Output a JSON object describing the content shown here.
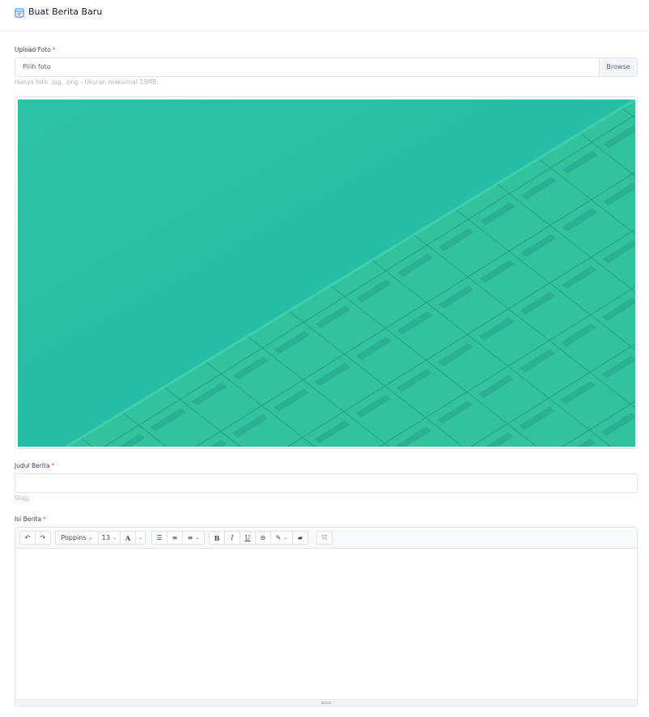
{
  "header": {
    "title": "Buat Berita Baru",
    "icon": "form-icon"
  },
  "upload": {
    "label": "Upload Foto",
    "required_mark": "*",
    "placeholder": "Pilih foto",
    "browse_label": "Browse",
    "hint": "Hanya foto .jpg, .png - Ukuran maksimal 15MB."
  },
  "title_field": {
    "label": "Judul Berita",
    "required_mark": "*",
    "value": "",
    "slug_text": "Slug: -"
  },
  "content_field": {
    "label": "Isi Berita",
    "required_mark": "*"
  },
  "toolbar": {
    "undo": "↶",
    "redo": "↷",
    "font_family": "Poppins",
    "font_size": "13",
    "font_color": "A",
    "unordered_list": "☰",
    "ordered_list": "≡",
    "paragraph": "≡",
    "bold": "B",
    "italic": "I",
    "underline": "U",
    "link": "⊖",
    "magic": "✎",
    "clear": "▰",
    "fullscreen": "⤧",
    "caret": "⌄"
  },
  "colors": {
    "accent": "#3699ff",
    "required": "#f64e60",
    "preview_base": "#2bc3a3"
  }
}
